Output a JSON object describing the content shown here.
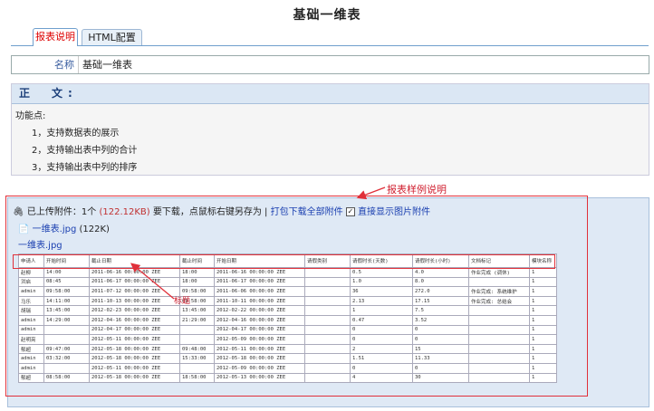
{
  "page_title": "基础一维表",
  "tabs": [
    {
      "label": "报表说明",
      "active": true
    },
    {
      "label": "HTML配置",
      "active": false
    }
  ],
  "name_row": {
    "label": "名称",
    "value": "基础一维表"
  },
  "content": {
    "heading": "正　文:",
    "intro": "功能点:",
    "items": [
      "1，支持数据表的展示",
      "2，支持输出表中列的合计",
      "3，支持输出表中列的排序"
    ]
  },
  "attachments": {
    "prefix": "已上传附件：1个",
    "size": "(122.12KB)",
    "hint": "要下载，点鼠标右键另存为",
    "separator": "|",
    "download_all": "打包下载全部附件",
    "show_images": "直接显示图片附件",
    "file_name": "一维表.jpg",
    "file_size": "(122K)",
    "image_link": "一维表.jpg"
  },
  "annotations": {
    "sample_note": "报表样例说明",
    "header_note": "标题"
  },
  "preview_table": {
    "columns": [
      "申请人",
      "开始时间",
      "截止日期",
      "截止时间",
      "开始日期",
      "请假类别",
      "请假时长(天数)",
      "请假时长(小时)",
      "文档标记",
      "模块名称"
    ],
    "rows": [
      [
        "赵柳",
        "14:00",
        "2011-06-16 00:00:00 ZEE",
        "18:00",
        "2011-06-16 00:00:00 ZEE",
        "",
        "0.5",
        "4.0",
        "作业完成 (调休)",
        "1"
      ],
      [
        "洪启",
        "08:45",
        "2011-06-17 00:00:00 ZEE",
        "18:00",
        "2011-06-17 00:00:00 ZEE",
        "",
        "1.0",
        "8.0",
        "",
        "1"
      ],
      [
        "admin",
        "09:58:00",
        "2011-07-12 00:00:00 ZEE",
        "09:58:00",
        "2011-06-06 00:00:00 ZEE",
        "",
        "36",
        "272.0",
        "作业完成: 系统维护",
        "1"
      ],
      [
        "马乐",
        "14:11:00",
        "2011-10-13 00:00:00 ZEE",
        "09:58:00",
        "2011-10-11 00:00:00 ZEE",
        "",
        "2.13",
        "17.15",
        "作业完成: 总结会",
        "1"
      ],
      [
        "胡瑞",
        "13:45:00",
        "2012-02-23 00:00:00 ZEE",
        "13:45:00",
        "2012-02-22 00:00:00 ZEE",
        "",
        "1",
        "7.5",
        "",
        "1"
      ],
      [
        "admin",
        "14:29:00",
        "2012-04-16 00:00:00 ZEE",
        "21:29:00",
        "2012-04-16 00:00:00 ZEE",
        "",
        "0.47",
        "3.52",
        "",
        "1"
      ],
      [
        "admin",
        "",
        "2012-04-17 00:00:00 ZEE",
        "",
        "2012-04-17 00:00:00 ZEE",
        "",
        "0",
        "0",
        "",
        "1"
      ],
      [
        "赵明亮",
        "",
        "2012-05-11 00:00:00 ZEE",
        "",
        "2012-05-09 00:00:00 ZEE",
        "",
        "0",
        "0",
        "",
        "1"
      ],
      [
        "郁超",
        "09:47:00",
        "2012-05-18 00:00:00 ZEE",
        "09:48:00",
        "2012-05-11 00:00:00 ZEE",
        "",
        "2",
        "15",
        "",
        "1"
      ],
      [
        "admin",
        "03:32:00",
        "2012-05-18 00:00:00 ZEE",
        "15:33:00",
        "2012-05-18 00:00:00 ZEE",
        "",
        "1.51",
        "11.33",
        "",
        "1"
      ],
      [
        "admin",
        "",
        "2012-05-11 00:00:00 ZEE",
        "",
        "2012-05-09 00:00:00 ZEE",
        "",
        "0",
        "0",
        "",
        "1"
      ],
      [
        "郁超",
        "08:58:00",
        "2012-05-18 00:00:00 ZEE",
        "18:58:00",
        "2012-05-13 00:00:00 ZEE",
        "",
        "4",
        "30",
        "",
        "1"
      ]
    ]
  }
}
